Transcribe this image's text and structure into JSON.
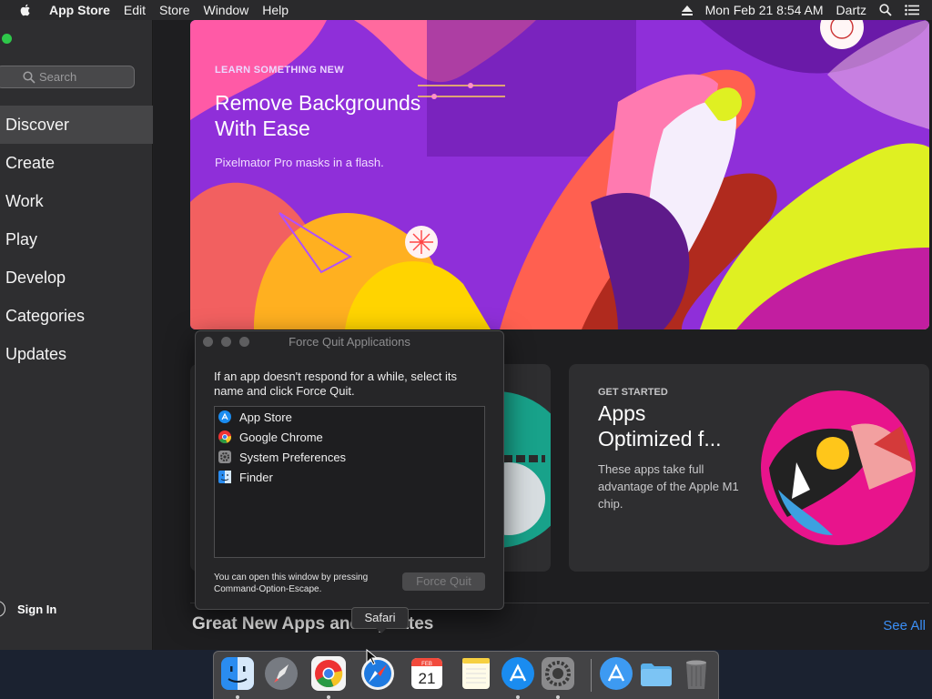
{
  "menubar": {
    "app_name": "App Store",
    "items": [
      "Edit",
      "Store",
      "Window",
      "Help"
    ],
    "datetime": "Mon Feb 21  8:54 AM",
    "user": "Dartz"
  },
  "sidebar": {
    "search_placeholder": "Search",
    "nav": [
      "Discover",
      "Create",
      "Work",
      "Play",
      "Develop",
      "Categories",
      "Updates"
    ],
    "active_index": 0,
    "sign_in": "Sign In"
  },
  "hero": {
    "kicker": "LEARN SOMETHING NEW",
    "title": "Remove Backgrounds With Ease",
    "subtitle": "Pixelmator Pro masks in a flash."
  },
  "card_get_started": {
    "kicker": "GET STARTED",
    "title": "Apps Optimized f...",
    "description": "These apps take full advantage of the Apple M1 chip."
  },
  "section": {
    "title": "Great New Apps and Updates",
    "see_all": "See All"
  },
  "force_quit": {
    "title": "Force Quit Applications",
    "message": "If an app doesn't respond for a while, select its name and click Force Quit.",
    "apps": [
      "App Store",
      "Google Chrome",
      "System Preferences",
      "Finder"
    ],
    "hint": "You can open this window by pressing Command-Option-Escape.",
    "button": "Force Quit"
  },
  "tooltip": "Safari",
  "dock": {
    "calendar_month": "FEB",
    "calendar_day": "21"
  },
  "colors": {
    "accent": "#3b8ff6",
    "hero_bg": "#8b2bd6"
  }
}
